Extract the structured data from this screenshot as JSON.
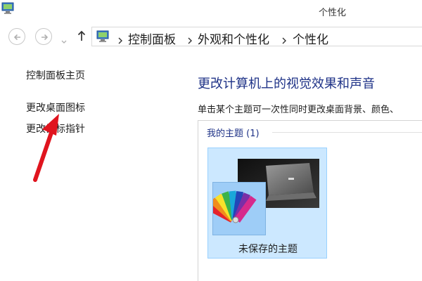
{
  "window": {
    "title": "个性化",
    "app_icon": "control-panel-icon"
  },
  "navigation": {
    "back_icon": "back-arrow-icon",
    "forward_icon": "forward-arrow-icon",
    "dropdown_icon": "chevron-down-icon",
    "up_icon": "up-arrow-icon",
    "breadcrumb": [
      "控制面板",
      "外观和个性化",
      "个性化"
    ]
  },
  "sidebar": {
    "links": [
      "控制面板主页",
      "更改桌面图标",
      "更改鼠标指针"
    ]
  },
  "annotation": {
    "arrow_color": "#e0141e",
    "arrow_icon": "red-arrow-annotation"
  },
  "main": {
    "heading": "更改计算机上的视觉效果和声音",
    "description": "单击某个主题可一次性同时更改桌面背景、颜色、",
    "group_label": "我的主题 (1)",
    "themes": [
      {
        "name": "未保存的主题",
        "selected": true
      }
    ]
  },
  "colors": {
    "link_blue": "#1e3287",
    "selection_bg": "#cce8ff",
    "selection_border": "#99d1ff"
  }
}
